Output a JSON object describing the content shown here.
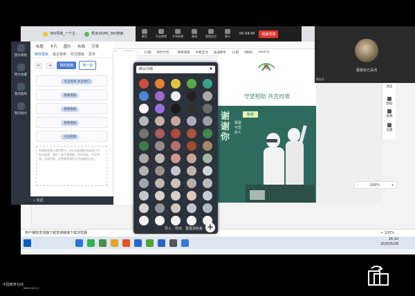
{
  "browser": {
    "tabs": [
      "360导航_一个主...",
      "秀米XIUMI_360搜索"
    ],
    "bookmarks": [
      "收藏",
      "手机收藏夹",
      "工作",
      "my",
      "art",
      "论文资料",
      "应届毕业...",
      "12期",
      "新时代党...",
      "网络课程",
      "中教互动",
      "晶通教育",
      "12期",
      "[教研]",
      "www.ip"
    ]
  },
  "meeting": {
    "items": [
      "静音",
      "开启视频",
      "共享屏幕",
      "邀请",
      "管理成员",
      "聊天"
    ],
    "time": "00:34:00",
    "end_label": "结束共享",
    "participant_name": "蔡康永已关闭",
    "tag": "蝶烩芳"
  },
  "editor": {
    "top_tabs": [
      "标题",
      "卡片",
      "图片",
      "布局",
      "引导"
    ],
    "left_nav": [
      "图文模板",
      "图文收藏",
      "我的图库",
      "我的图文"
    ],
    "panel_tabs": [
      "推荐模板",
      "最近使用",
      "样式模板",
      "更多"
    ],
    "new_template_label": "我的模板",
    "change_label": "换一批",
    "template_pills": [
      "点击图章 关注我们",
      "我要模板",
      "我要模板",
      "我要模板",
      "点击图章"
    ],
    "body_text": "在美丽画卷点滴积累中，在抗击疫情前线这段日子，面对疫情，我们一起守望相助。科学防疫、众志成城，共度时艰，这些都是我们心中温暖的记忆。",
    "collapse_label": "收起"
  },
  "color_popup": {
    "group_label": "默认分组",
    "footer": [
      "导入",
      "导出",
      "重置调色板"
    ],
    "add_symbol": "+",
    "swatches": [
      "#d24b3e",
      "#e88233",
      "#e2c33c",
      "#5aa84a",
      "#36a586",
      "#4a86d2",
      "#a368c9",
      "#f0f0f0",
      "#222222",
      "#a9a9a9",
      "#f3f3f3",
      "#9b6ee0",
      "#1a1a1a",
      "#2f2f2f",
      "#6b6b6b",
      "#b8b8b8",
      "#cbb1a8",
      "#c9a7a0",
      "#b5a9c0",
      "#9aa0a6",
      "#737373",
      "#a95d5d",
      "#b04a3a",
      "#a8553a",
      "#3f8a4e",
      "#3f7a4a",
      "#9c8a88",
      "#b57070",
      "#a24a2a",
      "#a58a6a",
      "#aaaaaa",
      "#c4b8b2",
      "#cf9790",
      "#c7a99a",
      "#a2b8a4",
      "#b4b4b4",
      "#a08f8a",
      "#c2c6ce",
      "#bfb6aa",
      "#d0d4d8",
      "#9fa6ad",
      "#c0b8b0",
      "#ccc2b6",
      "#b6b0a8",
      "#b7bbc0",
      "#c2c9cf",
      "#d8d0ca",
      "#d6d0c6",
      "#e0c8bc",
      "#c4cdd4",
      "#ddd3ce",
      "#8f969e",
      "#d0c7be",
      "#bcc6cc",
      "#b0bac2",
      "#f2f2f2",
      "#f2f2f2",
      "#f2f2f2",
      "#f2f2f2",
      "#f2f2f2"
    ]
  },
  "poster": {
    "title": "守望相助 共克时艰",
    "thanks": "谢谢你",
    "sub": "致最可爱的人",
    "tag": "致谢"
  },
  "tools": [
    "退出",
    "帮助",
    "投稿",
    "设置"
  ],
  "zoom": {
    "minus": "-",
    "value": "100%",
    "plus": "+"
  },
  "infobar": {
    "text": "用户播放发现器下载普通链接下载浏览器",
    "right": "+ 100%"
  },
  "taskbar": {
    "time": "16:10",
    "date": "2020/5/28",
    "icon_colors": [
      "#2a75d8",
      "#2fb14b",
      "#4a8f4a",
      "#e4a42d",
      "#e8501e",
      "#2d63c8",
      "#4da336",
      "#2d63c8",
      "#555555",
      "#3a78d8"
    ]
  },
  "watermark": {
    "text": "中国教育在线",
    "sub": "www.eol.cn"
  }
}
